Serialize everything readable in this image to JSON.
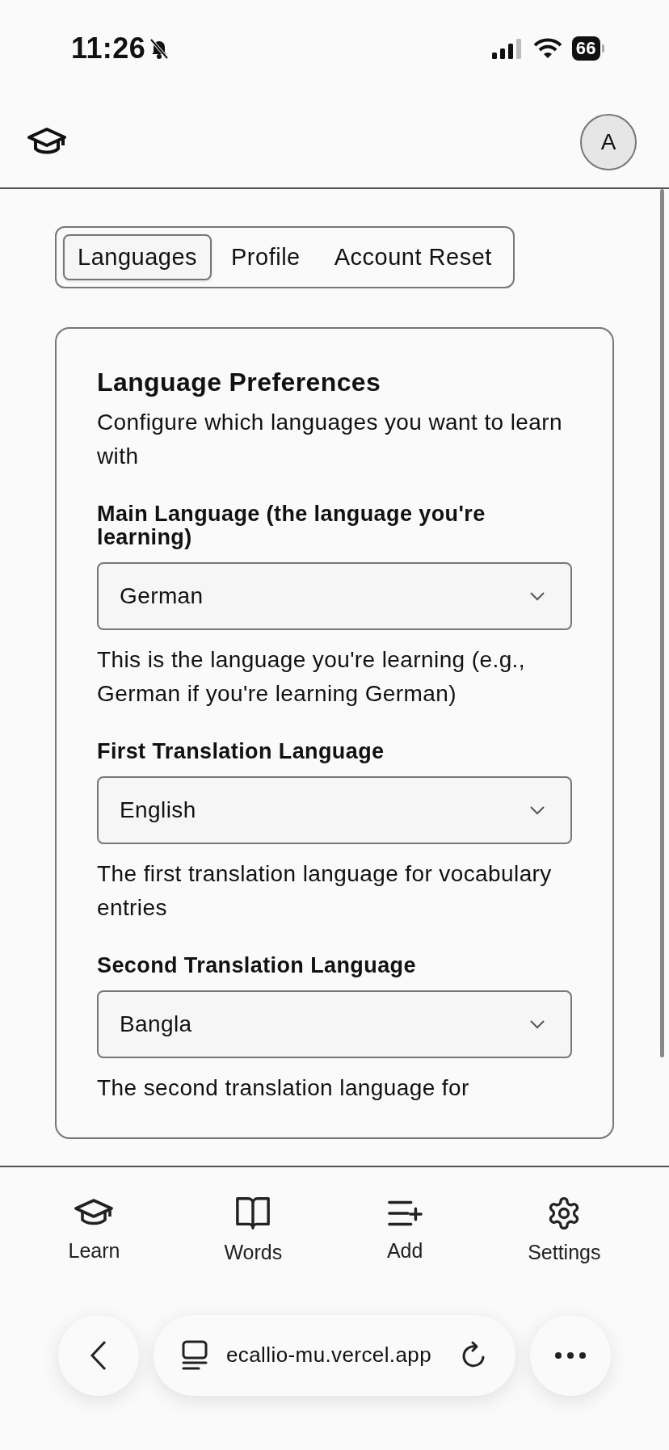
{
  "status_bar": {
    "time": "11:26",
    "battery": "66"
  },
  "header": {
    "avatar": "A"
  },
  "tabs": [
    {
      "label": "Languages",
      "selected": true
    },
    {
      "label": "Profile",
      "selected": false
    },
    {
      "label": "Account Reset",
      "selected": false
    }
  ],
  "card": {
    "title": "Language Preferences",
    "description": "Configure which languages you want to learn with",
    "fields": [
      {
        "label": "Main Language (the language you're learning)",
        "value": "German",
        "help": "This is the language you're learning (e.g., German if you're learning German)"
      },
      {
        "label": "First Translation Language",
        "value": "English",
        "help": "The first translation language for vocabulary entries"
      },
      {
        "label": "Second Translation Language",
        "value": "Bangla",
        "help": "The second translation language for"
      }
    ]
  },
  "bottom_nav": [
    {
      "kind": "learn",
      "label": "Learn"
    },
    {
      "kind": "words",
      "label": "Words"
    },
    {
      "kind": "add",
      "label": "Add"
    },
    {
      "kind": "settings",
      "label": "Settings"
    }
  ],
  "browser": {
    "url": "ecallio-mu.vercel.app"
  }
}
